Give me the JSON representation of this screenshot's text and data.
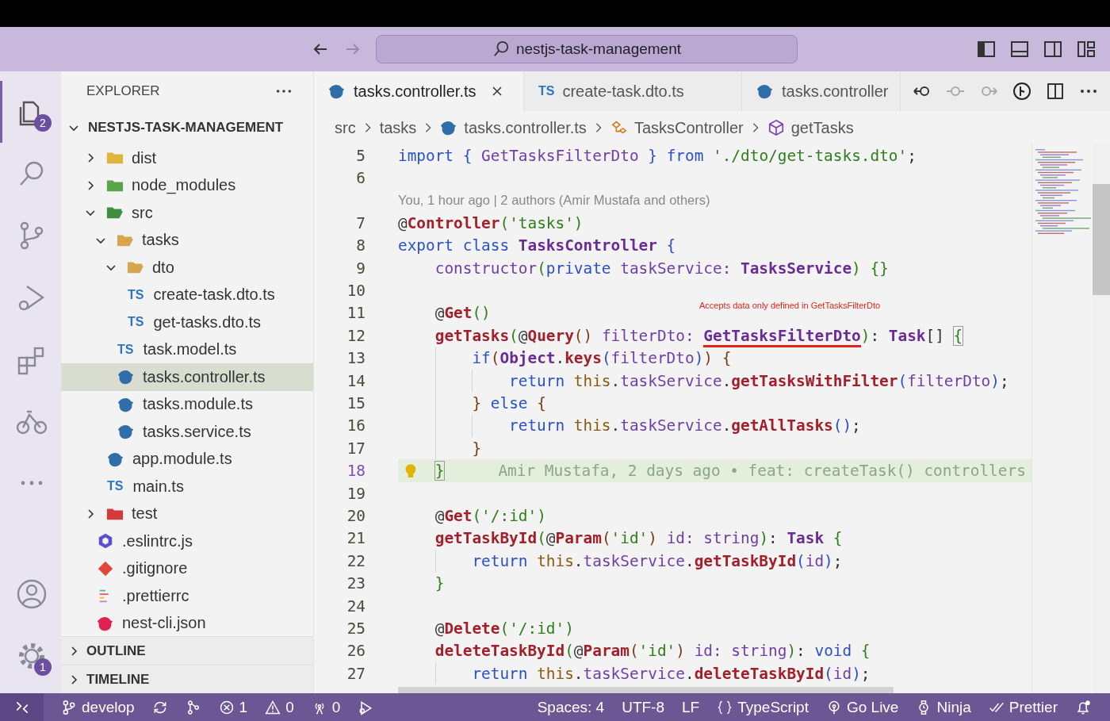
{
  "title_bar": {
    "search": "nestjs-task-management"
  },
  "activity_bar": [
    {
      "kind": "files",
      "selected": true,
      "badge": "2"
    },
    {
      "kind": "search",
      "selected": false
    },
    {
      "kind": "source-control",
      "selected": false
    },
    {
      "kind": "run",
      "selected": false
    },
    {
      "kind": "extensions",
      "selected": false
    },
    {
      "kind": "bike",
      "selected": false
    },
    {
      "kind": "more",
      "selected": false
    }
  ],
  "activity_bar_bottom": [
    {
      "kind": "account"
    },
    {
      "kind": "settings",
      "badge": "1"
    }
  ],
  "sidebar": {
    "title": "EXPLORER",
    "project": {
      "title": "NESTJS-TASK-MANAGEMENT",
      "expanded": true
    },
    "tree": [
      {
        "name": "dist",
        "kind": "folder-dist",
        "expanded": false,
        "selected": false
      },
      {
        "name": "node_modules",
        "kind": "folder-node",
        "expanded": false,
        "selected": false
      },
      {
        "name": "src",
        "kind": "folder-src",
        "expanded": true,
        "selected": false,
        "children": [
          {
            "name": "tasks",
            "kind": "folder",
            "expanded": true,
            "selected": false,
            "children": [
              {
                "name": "dto",
                "kind": "folder",
                "expanded": true,
                "selected": false,
                "children": [
                  {
                    "name": "create-task.dto.ts",
                    "kind": "ts",
                    "badge": "TS",
                    "selected": false
                  },
                  {
                    "name": "get-tasks.dto.ts",
                    "kind": "ts",
                    "badge": "TS",
                    "selected": false
                  }
                ]
              },
              {
                "name": "task.model.ts",
                "kind": "ts",
                "badge": "TS",
                "selected": false
              },
              {
                "name": "tasks.controller.ts",
                "kind": "nest",
                "selected": true
              },
              {
                "name": "tasks.module.ts",
                "kind": "nest",
                "selected": false
              },
              {
                "name": "tasks.service.ts",
                "kind": "nest",
                "selected": false
              }
            ]
          },
          {
            "name": "app.module.ts",
            "kind": "nest",
            "selected": false
          },
          {
            "name": "main.ts",
            "kind": "ts",
            "badge": "TS",
            "selected": false
          }
        ]
      },
      {
        "name": "test",
        "kind": "folder-test",
        "expanded": false,
        "selected": false
      },
      {
        "name": ".eslintrc.js",
        "kind": "eslint",
        "selected": false
      },
      {
        "name": ".gitignore",
        "kind": "git",
        "selected": false
      },
      {
        "name": ".prettierrc",
        "kind": "prettier",
        "selected": false
      },
      {
        "name": "nest-cli.json",
        "kind": "nest-red",
        "selected": false
      }
    ],
    "sections": [
      {
        "title": "OUTLINE",
        "expanded": false
      },
      {
        "title": "TIMELINE",
        "expanded": false
      }
    ]
  },
  "tabs": [
    {
      "label": "tasks.controller.ts",
      "kind": "nest",
      "selected": true
    },
    {
      "label": "create-task.dto.ts",
      "kind": "ts",
      "badge": "TS",
      "selected": false
    },
    {
      "label": "tasks.controller",
      "kind": "nest",
      "selected": false
    }
  ],
  "breadcrumbs": [
    {
      "label": "src",
      "kind": "plain"
    },
    {
      "label": "tasks",
      "kind": "plain"
    },
    {
      "label": "tasks.controller.ts",
      "kind": "nest"
    },
    {
      "label": "TasksController",
      "kind": "class"
    },
    {
      "label": "getTasks",
      "kind": "method"
    }
  ],
  "editor": {
    "lines": [
      {
        "kind": "code",
        "number": "5",
        "current": false,
        "highlighted": false,
        "tokens": [
          {
            "text": "import",
            "kind": "kw"
          },
          {
            "text": " {",
            "kind": "b1"
          },
          {
            "text": " GetTasksFilterDto ",
            "kind": "id"
          },
          {
            "text": "}",
            "kind": "b1"
          },
          {
            "text": " from",
            "kind": "kw"
          },
          {
            "text": " './dto/get-tasks.dto'",
            "kind": "str"
          },
          {
            "text": ";",
            "kind": "p"
          }
        ]
      },
      {
        "kind": "code",
        "number": "6",
        "current": false,
        "highlighted": false
      },
      {
        "kind": "lens",
        "text": "You, 1 hour ago | 2 authors (Amir Mustafa and others)"
      },
      {
        "kind": "code",
        "number": "7",
        "current": false,
        "highlighted": false,
        "tokens": [
          {
            "text": "@",
            "kind": "p"
          },
          {
            "text": "Controller",
            "kind": "fn"
          },
          {
            "text": "(",
            "kind": "b2"
          },
          {
            "text": "'tasks'",
            "kind": "str"
          },
          {
            "text": ")",
            "kind": "b2"
          }
        ]
      },
      {
        "kind": "code",
        "number": "8",
        "current": false,
        "highlighted": false,
        "tokens": [
          {
            "text": "export",
            "kind": "kw"
          },
          {
            "text": " class",
            "kind": "kw"
          },
          {
            "text": " TasksController",
            "kind": "type"
          },
          {
            "text": " {",
            "kind": "b1"
          }
        ]
      },
      {
        "kind": "code",
        "number": "9",
        "current": false,
        "highlighted": false,
        "tokens": [
          {
            "text": "    constructor",
            "kind": "id"
          },
          {
            "text": "(",
            "kind": "b2"
          },
          {
            "text": "private",
            "kind": "kw"
          },
          {
            "text": " taskService: ",
            "kind": "id"
          },
          {
            "text": "TasksService",
            "kind": "type"
          },
          {
            "text": ")",
            "kind": "b2"
          },
          {
            "text": " {}",
            "kind": "b2"
          }
        ]
      },
      {
        "kind": "code",
        "number": "10",
        "current": false,
        "highlighted": false
      },
      {
        "kind": "code",
        "number": "11",
        "current": false,
        "highlighted": false,
        "tokens": [
          {
            "text": "    @",
            "kind": "p"
          },
          {
            "text": "Get",
            "kind": "fn"
          },
          {
            "text": "()",
            "kind": "b2"
          }
        ],
        "note": "Accepts data only defined in GetTasksFilterDto"
      },
      {
        "kind": "code",
        "number": "12",
        "current": false,
        "highlighted": false,
        "tokens": [
          {
            "text": "    getTasks",
            "kind": "fn"
          },
          {
            "text": "(",
            "kind": "b2"
          },
          {
            "text": "@",
            "kind": "p"
          },
          {
            "text": "Query",
            "kind": "fn"
          },
          {
            "text": "()",
            "kind": "b3"
          },
          {
            "text": " filterDto: ",
            "kind": "id"
          },
          {
            "text": "GetTasksFilterDto",
            "kind": "type",
            "squiggle": true
          },
          {
            "text": ")",
            "kind": "b2"
          },
          {
            "text": ": ",
            "kind": "p"
          },
          {
            "text": "Task",
            "kind": "type"
          },
          {
            "text": "[] ",
            "kind": "p"
          },
          {
            "text": "{",
            "kind": "b2",
            "bracket_match": true
          }
        ]
      },
      {
        "kind": "code",
        "number": "13",
        "current": false,
        "highlighted": false,
        "tokens": [
          {
            "text": "        if",
            "kind": "kw"
          },
          {
            "text": "(",
            "kind": "b3"
          },
          {
            "text": "Object",
            "kind": "type"
          },
          {
            "text": ".",
            "kind": "p"
          },
          {
            "text": "keys",
            "kind": "fn"
          },
          {
            "text": "(",
            "kind": "b1"
          },
          {
            "text": "filterDto",
            "kind": "id"
          },
          {
            "text": ")",
            "kind": "b1"
          },
          {
            "text": ")",
            "kind": "b3"
          },
          {
            "text": " {",
            "kind": "b3"
          }
        ]
      },
      {
        "kind": "code",
        "number": "14",
        "current": false,
        "highlighted": false,
        "tokens": [
          {
            "text": "            return",
            "kind": "kw"
          },
          {
            "text": " this",
            "kind": "this"
          },
          {
            "text": ".",
            "kind": "p"
          },
          {
            "text": "taskService",
            "kind": "id"
          },
          {
            "text": ".",
            "kind": "p"
          },
          {
            "text": "getTasksWithFilter",
            "kind": "fn"
          },
          {
            "text": "(",
            "kind": "b1"
          },
          {
            "text": "filterDto",
            "kind": "id"
          },
          {
            "text": ")",
            "kind": "b1"
          },
          {
            "text": ";",
            "kind": "p"
          }
        ]
      },
      {
        "kind": "code",
        "number": "15",
        "current": false,
        "highlighted": false,
        "tokens": [
          {
            "text": "        }",
            "kind": "b3"
          },
          {
            "text": " else",
            "kind": "kw"
          },
          {
            "text": " {",
            "kind": "b3"
          }
        ]
      },
      {
        "kind": "code",
        "number": "16",
        "current": false,
        "highlighted": false,
        "tokens": [
          {
            "text": "            return",
            "kind": "kw"
          },
          {
            "text": " this",
            "kind": "this"
          },
          {
            "text": ".",
            "kind": "p"
          },
          {
            "text": "taskService",
            "kind": "id"
          },
          {
            "text": ".",
            "kind": "p"
          },
          {
            "text": "getAllTasks",
            "kind": "fn"
          },
          {
            "text": "()",
            "kind": "b1"
          },
          {
            "text": ";",
            "kind": "p"
          }
        ]
      },
      {
        "kind": "code",
        "number": "17",
        "current": false,
        "highlighted": false,
        "tokens": [
          {
            "text": "        }",
            "kind": "b3"
          }
        ]
      },
      {
        "kind": "code",
        "number": "18",
        "current": true,
        "highlighted": true,
        "lightbulb": true,
        "tokens": [
          {
            "text": "    }",
            "kind": "b2",
            "bracket_match": true
          }
        ],
        "blame": "Amir Mustafa, 2 days ago • feat: createTask() controllers"
      },
      {
        "kind": "code",
        "number": "19",
        "current": false,
        "highlighted": false
      },
      {
        "kind": "code",
        "number": "20",
        "current": false,
        "highlighted": false,
        "tokens": [
          {
            "text": "    @",
            "kind": "p"
          },
          {
            "text": "Get",
            "kind": "fn"
          },
          {
            "text": "(",
            "kind": "b2"
          },
          {
            "text": "'/:id'",
            "kind": "str"
          },
          {
            "text": ")",
            "kind": "b2"
          }
        ]
      },
      {
        "kind": "code",
        "number": "21",
        "current": false,
        "highlighted": false,
        "tokens": [
          {
            "text": "    getTaskById",
            "kind": "fn"
          },
          {
            "text": "(",
            "kind": "b2"
          },
          {
            "text": "@",
            "kind": "p"
          },
          {
            "text": "Param",
            "kind": "fn"
          },
          {
            "text": "(",
            "kind": "b3"
          },
          {
            "text": "'id'",
            "kind": "str"
          },
          {
            "text": ")",
            "kind": "b3"
          },
          {
            "text": " id: string",
            "kind": "id"
          },
          {
            "text": ")",
            "kind": "b2"
          },
          {
            "text": ": ",
            "kind": "p"
          },
          {
            "text": "Task",
            "kind": "type"
          },
          {
            "text": " {",
            "kind": "b2"
          }
        ]
      },
      {
        "kind": "code",
        "number": "22",
        "current": false,
        "highlighted": false,
        "tokens": [
          {
            "text": "        return",
            "kind": "kw"
          },
          {
            "text": " this",
            "kind": "this"
          },
          {
            "text": ".",
            "kind": "p"
          },
          {
            "text": "taskService",
            "kind": "id"
          },
          {
            "text": ".",
            "kind": "p"
          },
          {
            "text": "getTaskById",
            "kind": "fn"
          },
          {
            "text": "(",
            "kind": "b1"
          },
          {
            "text": "id",
            "kind": "id"
          },
          {
            "text": ")",
            "kind": "b1"
          },
          {
            "text": ";",
            "kind": "p"
          }
        ]
      },
      {
        "kind": "code",
        "number": "23",
        "current": false,
        "highlighted": false,
        "tokens": [
          {
            "text": "    }",
            "kind": "b2"
          }
        ]
      },
      {
        "kind": "code",
        "number": "24",
        "current": false,
        "highlighted": false
      },
      {
        "kind": "code",
        "number": "25",
        "current": false,
        "highlighted": false,
        "tokens": [
          {
            "text": "    @",
            "kind": "p"
          },
          {
            "text": "Delete",
            "kind": "fn"
          },
          {
            "text": "(",
            "kind": "b2"
          },
          {
            "text": "'/:id'",
            "kind": "str"
          },
          {
            "text": ")",
            "kind": "b2"
          }
        ]
      },
      {
        "kind": "code",
        "number": "26",
        "current": false,
        "highlighted": false,
        "tokens": [
          {
            "text": "    deleteTaskById",
            "kind": "fn"
          },
          {
            "text": "(",
            "kind": "b2"
          },
          {
            "text": "@",
            "kind": "p"
          },
          {
            "text": "Param",
            "kind": "fn"
          },
          {
            "text": "(",
            "kind": "b3"
          },
          {
            "text": "'id'",
            "kind": "str"
          },
          {
            "text": ")",
            "kind": "b3"
          },
          {
            "text": " id: string",
            "kind": "id"
          },
          {
            "text": ")",
            "kind": "b2"
          },
          {
            "text": ": ",
            "kind": "p"
          },
          {
            "text": "void",
            "kind": "kw"
          },
          {
            "text": " {",
            "kind": "b2"
          }
        ]
      },
      {
        "kind": "code",
        "number": "27",
        "current": false,
        "highlighted": false,
        "tokens": [
          {
            "text": "        return",
            "kind": "kw"
          },
          {
            "text": " this",
            "kind": "this"
          },
          {
            "text": ".",
            "kind": "p"
          },
          {
            "text": "taskService",
            "kind": "id"
          },
          {
            "text": ".",
            "kind": "p"
          },
          {
            "text": "deleteTaskById",
            "kind": "fn"
          },
          {
            "text": "(",
            "kind": "b1"
          },
          {
            "text": "id",
            "kind": "id"
          },
          {
            "text": ")",
            "kind": "b1"
          },
          {
            "text": ";",
            "kind": "p"
          }
        ]
      }
    ]
  },
  "status_bar": {
    "left": [
      {
        "kind": "remote"
      },
      {
        "kind": "branch",
        "label": "develop"
      },
      {
        "kind": "sync"
      },
      {
        "kind": "graph"
      },
      {
        "kind": "errors",
        "label": "1"
      },
      {
        "kind": "warnings",
        "label": "0"
      },
      {
        "kind": "ports",
        "label": "0"
      },
      {
        "kind": "debug"
      }
    ],
    "right": [
      {
        "kind": "text",
        "label": "Spaces: 4"
      },
      {
        "kind": "text",
        "label": "UTF-8"
      },
      {
        "kind": "text",
        "label": "LF"
      },
      {
        "kind": "braces",
        "label": "TypeScript"
      },
      {
        "kind": "broadcast",
        "label": "Go Live"
      },
      {
        "kind": "watch",
        "label": "Ninja"
      },
      {
        "kind": "checks",
        "label": "Prettier"
      },
      {
        "kind": "bell"
      }
    ]
  }
}
